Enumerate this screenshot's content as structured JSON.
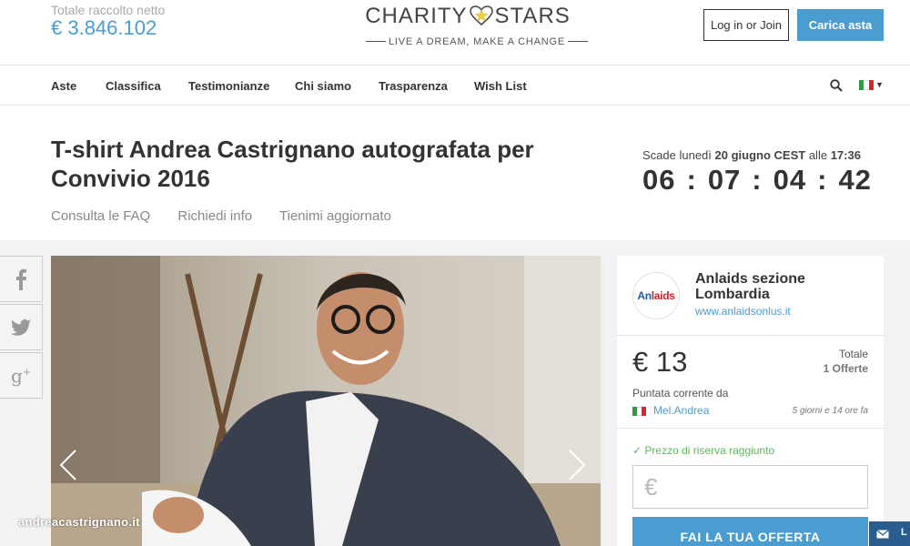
{
  "header": {
    "total_label": "Totale raccolto netto",
    "total_value": "€ 3.846.102",
    "logo_left": "CHARITY",
    "logo_right": "STARS",
    "tagline": "LIVE A DREAM, MAKE A CHANGE",
    "login_label": "Log in or Join",
    "upload_label": "Carica asta"
  },
  "nav": {
    "items": [
      "Aste",
      "Classifica",
      "Testimonianze",
      "Chi siamo",
      "Trasparenza",
      "Wish List"
    ],
    "language": "IT"
  },
  "auction": {
    "title": "T-shirt Andrea Castrignano autografata per Convivio 2016",
    "links": [
      "Consulta le FAQ",
      "Richiedi info",
      "Tienimi aggiornato"
    ],
    "expire_prefix": "Scade lunedì",
    "expire_date": "20 giugno CEST",
    "expire_mid": "alle",
    "expire_time": "17:36",
    "countdown": [
      "06",
      "07",
      "04",
      "42"
    ],
    "watermark": "andreacastrignano.it"
  },
  "social": [
    "f",
    "t",
    "g+"
  ],
  "organization": {
    "logo_text_a": "An",
    "logo_text_b": "laids",
    "name": "Anlaids sezione Lombardia",
    "website": "www.anlaidsonlus.it"
  },
  "bid": {
    "price": "€ 13",
    "total_label": "Totale",
    "offers": "1 Offerte",
    "current_label": "Puntata corrente da",
    "bidder": "Mel.Andrea",
    "time_ago": "5 giorni e 14 ore fa"
  },
  "offer": {
    "reserve_msg": "Prezzo di riserva raggiunto",
    "currency_symbol": "€",
    "button_label": "FAI LA TUA OFFERTA"
  },
  "colors": {
    "accent": "#4a9dd0",
    "success": "#5cb85c",
    "chat": "#2a5d8f"
  }
}
